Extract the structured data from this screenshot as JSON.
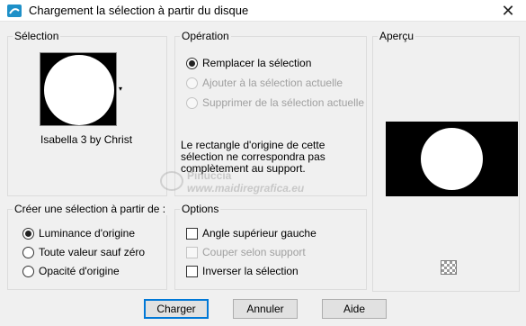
{
  "window": {
    "title": "Chargement la sélection à partir du disque",
    "close_symbol": "✕"
  },
  "selection": {
    "label": "Sélection",
    "item_name": "Isabella 3 by Christ",
    "dropdown_symbol": "▾"
  },
  "operation": {
    "label": "Opération",
    "options": [
      {
        "label": "Remplacer la sélection",
        "checked": true,
        "enabled": true
      },
      {
        "label": "Ajouter à la sélection actuelle",
        "checked": false,
        "enabled": false
      },
      {
        "label": "Supprimer de la sélection actuelle",
        "checked": false,
        "enabled": false
      }
    ],
    "warning_line1": "Le rectangle d'origine de cette",
    "warning_line2": "sélection ne correspondra pas",
    "warning_line3": "complètement au support."
  },
  "preview": {
    "label": "Aperçu"
  },
  "create_from": {
    "label": "Créer une sélection à partir de :",
    "options": [
      {
        "label": "Luminance d'origine",
        "checked": true
      },
      {
        "label": "Toute valeur sauf zéro",
        "checked": false
      },
      {
        "label": "Opacité d'origine",
        "checked": false
      }
    ]
  },
  "options": {
    "label": "Options",
    "items": [
      {
        "label": "Angle supérieur gauche",
        "checked": false,
        "enabled": true
      },
      {
        "label": "Couper selon support",
        "checked": false,
        "enabled": false
      },
      {
        "label": "Inverser la sélection",
        "checked": false,
        "enabled": true
      }
    ]
  },
  "buttons": {
    "load": "Charger",
    "cancel": "Annuler",
    "help": "Aide"
  },
  "watermark": {
    "line1": "Pinuccia",
    "line2": "www.maidiregrafica.eu"
  },
  "colors": {
    "default_button_border": "#0078d7",
    "title_icon": "#1e90c8"
  }
}
